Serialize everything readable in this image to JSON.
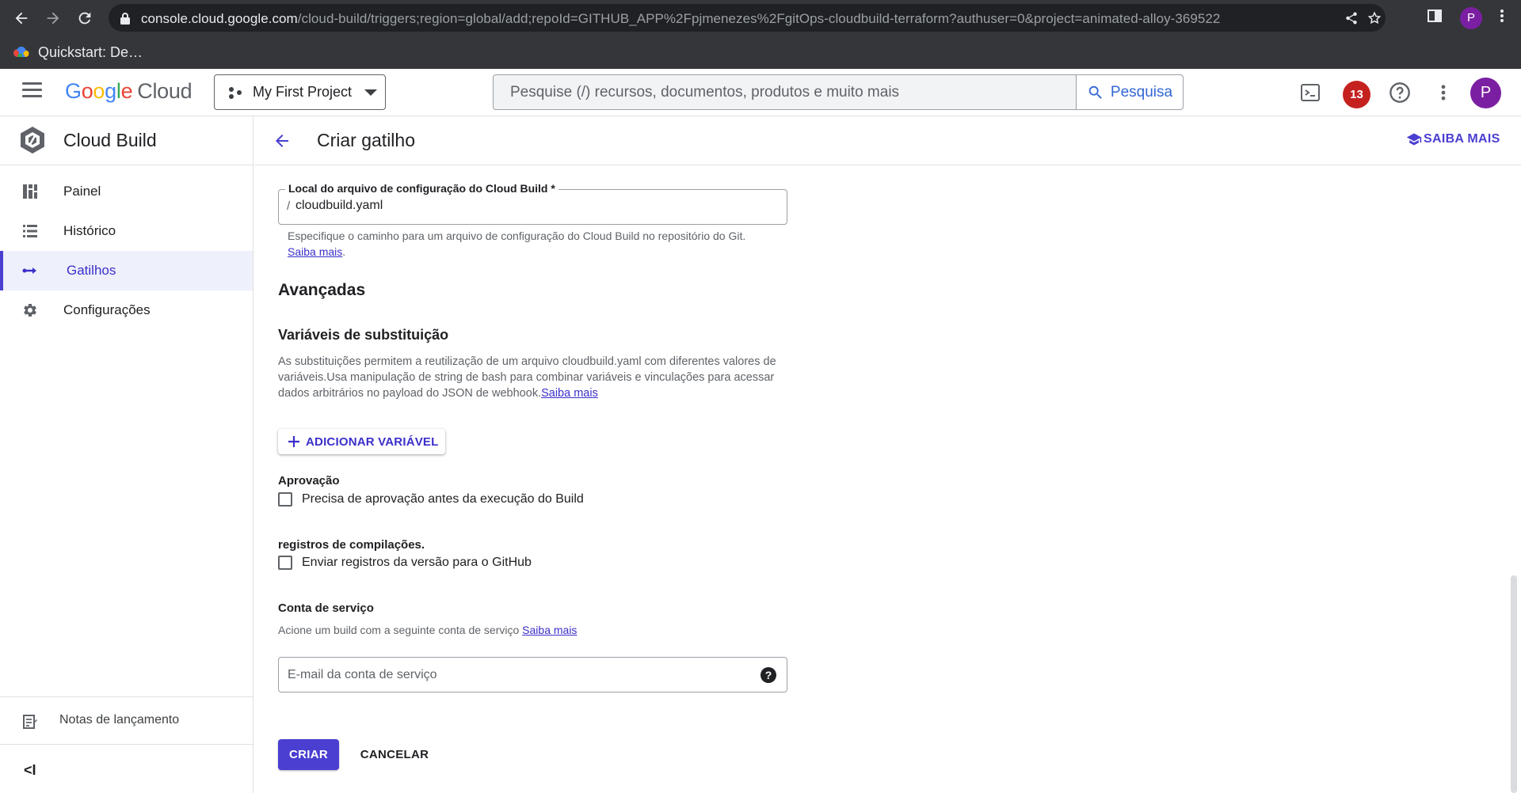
{
  "browser": {
    "url_host": "console.cloud.google.com",
    "url_path": "/cloud-build/triggers;region=global/add;repoId=GITHUB_APP%2Fpjmenezes%2FgitOps-cloudbuild-terraform?authuser=0&project=animated-alloy-369522",
    "profile_initial": "P",
    "bookmark_label": "Quickstart: De…"
  },
  "header": {
    "project_name": "My First Project",
    "search_placeholder": "Pesquise (/) recursos, documentos, produtos e muito mais",
    "search_button_label": "Pesquisa",
    "notification_count": "13",
    "avatar_initial": "P"
  },
  "sidebar": {
    "product_name": "Cloud Build",
    "items": [
      {
        "label": "Painel",
        "icon": "dashboard-icon"
      },
      {
        "label": "Histórico",
        "icon": "list-icon"
      },
      {
        "label": "Gatilhos",
        "icon": "trigger-arrows-icon",
        "active": true
      },
      {
        "label": "Configurações",
        "icon": "gear-icon"
      }
    ],
    "release_notes_label": "Notas de lançamento",
    "collapse_label": "<I"
  },
  "page": {
    "title": "Criar gatilho",
    "learn_more_label": "SAIBA MAIS"
  },
  "form": {
    "config_location": {
      "legend": "Local do arquivo de configuração do Cloud Build *",
      "prefix": "/",
      "value": "cloudbuild.yaml",
      "hint_text": "Especifique o caminho para um arquivo de configuração do Cloud Build no repositório do Git. ",
      "hint_link": "Saiba mais",
      "hint_end": "."
    },
    "advanced_heading": "Avançadas",
    "substitution": {
      "heading": "Variáveis de substituição",
      "description": "As substituições permitem a reutilização de um arquivo cloudbuild.yaml com diferentes valores de variáveis.Usa manipulação de string de bash para combinar variáveis e vinculações para acessar dados arbitrários no payload do JSON de webhook.",
      "link": "Saiba mais",
      "add_button": "ADICIONAR VARIÁVEL"
    },
    "approval": {
      "heading": "Aprovação",
      "checkbox_label": "Precisa de aprovação antes da execução do Build"
    },
    "build_logs": {
      "heading": "registros de compilações.",
      "checkbox_label": "Enviar registros da versão para o GitHub"
    },
    "service_account": {
      "heading": "Conta de serviço",
      "description": "Acione um build com a seguinte conta de serviço ",
      "link": "Saiba mais",
      "placeholder": "E-mail da conta de serviço"
    },
    "create_button": "CRIAR",
    "cancel_button": "CANCELAR"
  },
  "colors": {
    "accent": "#4a3fd1",
    "chrome": "#35363a",
    "notification_badge": "#c5221f",
    "avatar": "#7b1fa2"
  }
}
